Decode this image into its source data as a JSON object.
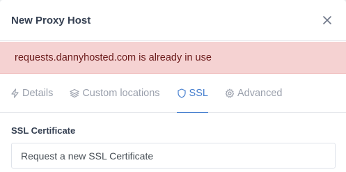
{
  "modal": {
    "title": "New Proxy Host",
    "close_icon": "close-icon"
  },
  "alert": {
    "message": "requests.dannyhosted.com is already in use",
    "background_color": "#f5d2d2"
  },
  "tabs": [
    {
      "label": "Details",
      "icon": "lightning-bolt-icon",
      "active": false
    },
    {
      "label": "Custom locations",
      "icon": "layers-icon",
      "active": false
    },
    {
      "label": "SSL",
      "icon": "shield-icon",
      "active": true
    },
    {
      "label": "Advanced",
      "icon": "gear-icon",
      "active": false
    }
  ],
  "ssl": {
    "certificate_label": "SSL Certificate",
    "certificate_value": "Request a new SSL Certificate"
  },
  "colors": {
    "accent": "#467fcf",
    "muted_tab": "#9aa0ac"
  }
}
